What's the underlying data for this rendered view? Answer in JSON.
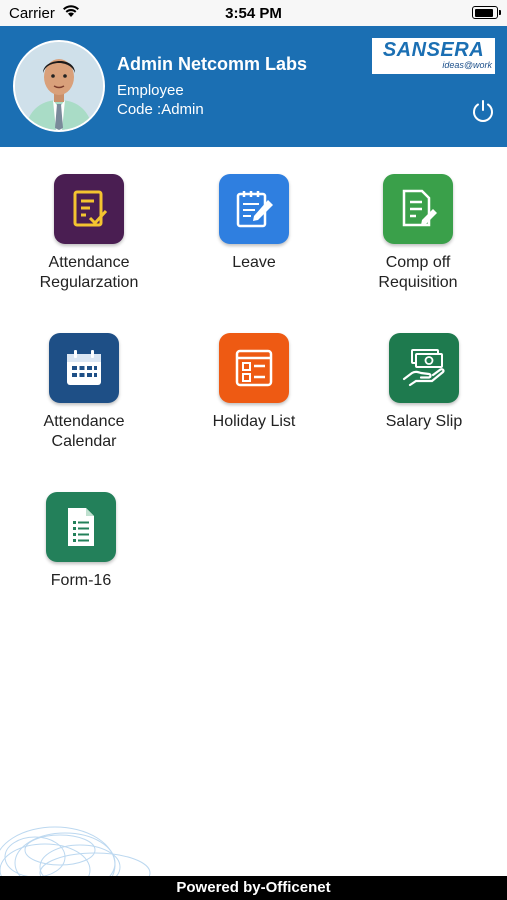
{
  "status_bar": {
    "carrier": "Carrier",
    "time": "3:54 PM",
    "battery_level": 0.9
  },
  "header": {
    "name": "Admin Netcomm Labs",
    "role": "Employee",
    "code": "Code :Admin",
    "logo": {
      "brand": "SANSERA",
      "tagline": "ideas@work"
    },
    "color": "#1b6fb3"
  },
  "tiles": [
    {
      "label": "Attendance\nRegularzation",
      "icon": "attendance-regularization-icon",
      "color": "#4a1e52"
    },
    {
      "label": "Leave",
      "icon": "leave-note-icon",
      "color": "#2f7fe0"
    },
    {
      "label": "Comp off\nRequisition",
      "icon": "comp-off-document-icon",
      "color": "#3aa04a"
    },
    {
      "label": "Attendance Calendar",
      "icon": "calendar-icon",
      "color": "#1e4f86"
    },
    {
      "label": "Holiday List",
      "icon": "holiday-list-icon",
      "color": "#ee5a13"
    },
    {
      "label": "Salary Slip",
      "icon": "salary-money-hand-icon",
      "color": "#1e7a4e"
    },
    {
      "label": "Form-16",
      "icon": "form-document-icon",
      "color": "#23805a"
    }
  ],
  "footer": {
    "text": "Powered by-Officenet"
  }
}
